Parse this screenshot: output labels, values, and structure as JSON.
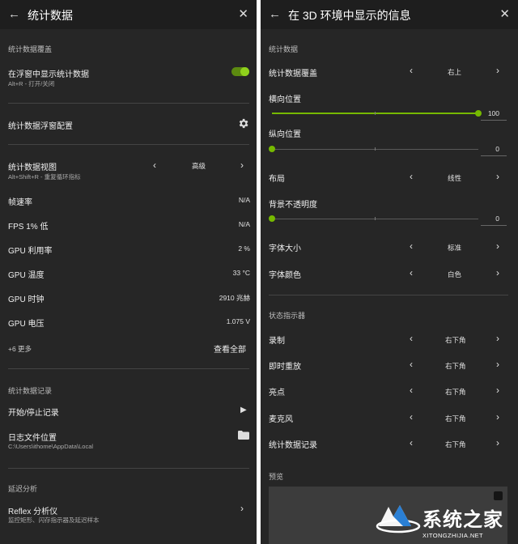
{
  "left": {
    "header": {
      "title": "统计数据"
    },
    "overlay_section": {
      "heading": "统计数据覆盖",
      "show_in_overlay": {
        "label": "在浮窗中显示统计数据",
        "hint": "Alt+R - 打开/关闭",
        "enabled": true
      },
      "overlay_config": {
        "label": "统计数据浮窗配置"
      },
      "stats_view": {
        "label": "统计数据视图",
        "hint": "Alt+Shift+R - 重复循环指标",
        "value": "高级"
      },
      "metrics": [
        {
          "label": "帧速率",
          "value": "N/A"
        },
        {
          "label": "FPS 1% 低",
          "value": "N/A"
        },
        {
          "label": "GPU 利用率",
          "value": "2 %"
        },
        {
          "label": "GPU 温度",
          "value": "33 °C"
        },
        {
          "label": "GPU 时钟",
          "value": "2910 兆赫"
        },
        {
          "label": "GPU 电压",
          "value": "1.075 V"
        }
      ],
      "more": {
        "label": "+6 更多",
        "link": "查看全部"
      }
    },
    "logging_section": {
      "heading": "统计数据记录",
      "start_stop": {
        "label": "开始/停止记录"
      },
      "log_location": {
        "label": "日志文件位置",
        "path": "C:\\Users\\ithome\\AppData\\Local"
      }
    },
    "latency_section": {
      "heading": "延迟分析",
      "reflex": {
        "label": "Reflex 分析仪",
        "hint": "监控矩形、闪存指示器及延迟样本"
      }
    }
  },
  "right": {
    "header": {
      "title": "在 3D 环境中显示的信息"
    },
    "stats_section": {
      "heading": "统计数据",
      "overlay_position": {
        "label": "统计数据覆盖",
        "value": "右上"
      },
      "horizontal": {
        "label": "横向位置",
        "value": "100",
        "level": 1.0
      },
      "vertical": {
        "label": "纵向位置",
        "value": "0",
        "level": 0.0
      },
      "layout": {
        "label": "布局",
        "value": "线性"
      },
      "bg_opacity": {
        "label": "背景不透明度",
        "value": "0",
        "level": 0.0
      },
      "font_size": {
        "label": "字体大小",
        "value": "标准"
      },
      "font_color": {
        "label": "字体颜色",
        "value": "白色"
      }
    },
    "status_section": {
      "heading": "状态指示器",
      "items": [
        {
          "label": "录制",
          "value": "右下角"
        },
        {
          "label": "即时重放",
          "value": "右下角"
        },
        {
          "label": "亮点",
          "value": "右下角"
        },
        {
          "label": "麦克风",
          "value": "右下角"
        },
        {
          "label": "统计数据记录",
          "value": "右下角"
        }
      ]
    },
    "preview": {
      "heading": "预览"
    }
  },
  "watermark": {
    "text": "系统之家",
    "url": "XITONGZHIJIA.NET"
  },
  "colors": {
    "accent": "#76b900",
    "panel": "#262626",
    "header": "#1e1e1e"
  },
  "icons": {
    "back": "arrow-left-icon",
    "close": "close-icon",
    "settings": "gear-icon",
    "play": "play-icon",
    "folder": "folder-icon"
  }
}
